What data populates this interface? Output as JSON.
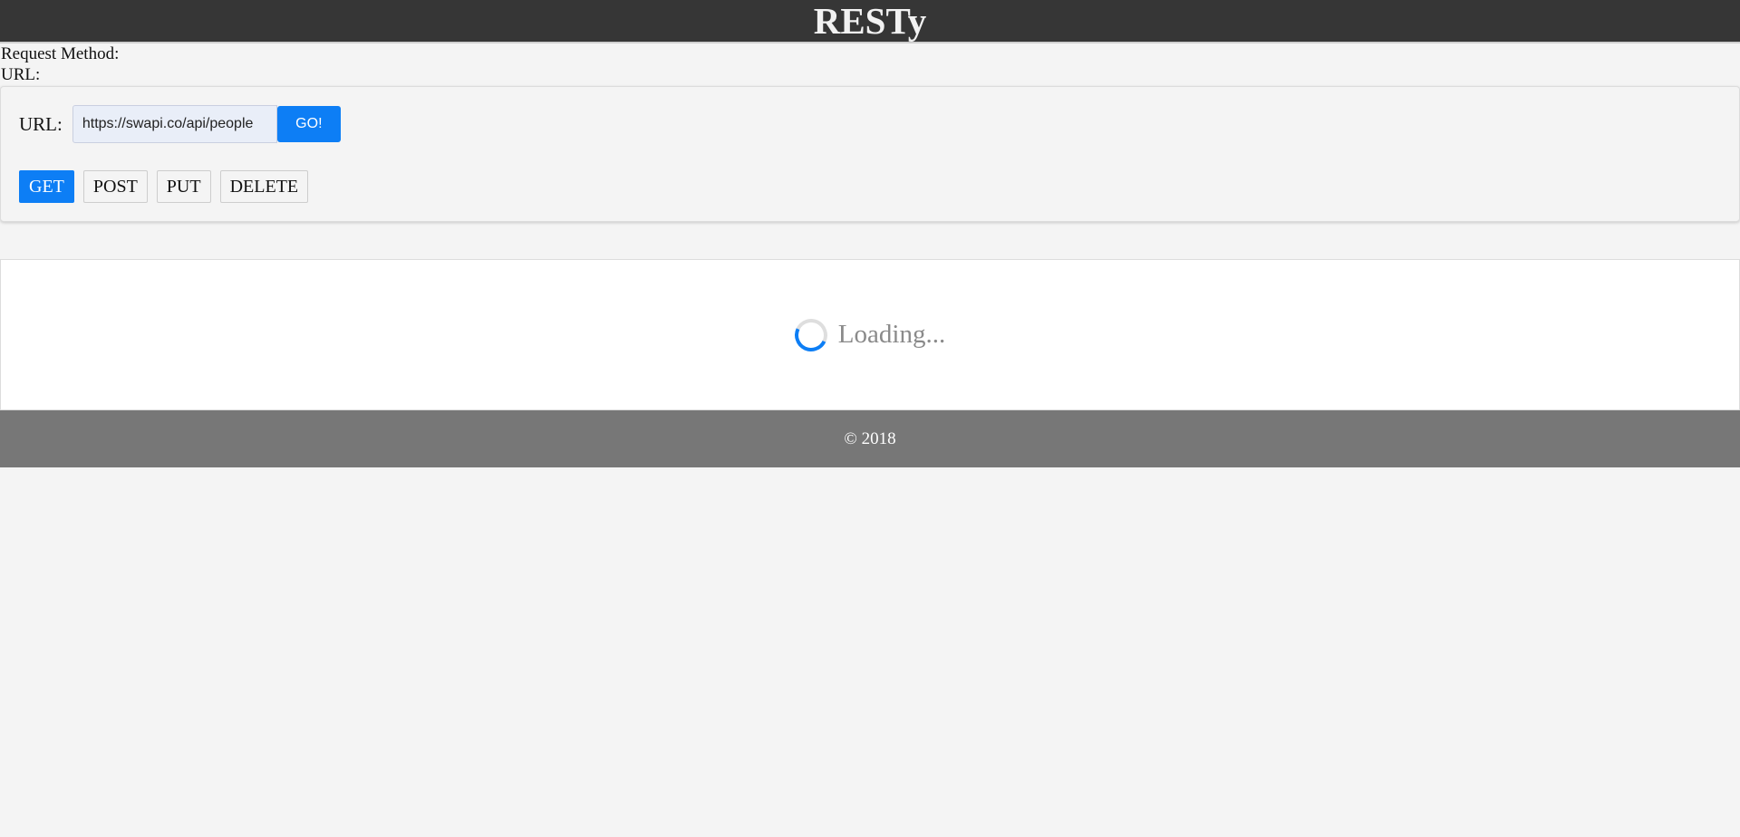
{
  "header": {
    "title": "RESTy"
  },
  "status": {
    "method_label": "Request Method:",
    "url_label": "URL:"
  },
  "form": {
    "url_label": "URL:",
    "url_value": "https://swapi.co/api/people",
    "go_label": "GO!",
    "methods": [
      {
        "label": "GET",
        "active": true
      },
      {
        "label": "POST",
        "active": false
      },
      {
        "label": "PUT",
        "active": false
      },
      {
        "label": "DELETE",
        "active": false
      }
    ]
  },
  "results": {
    "loading_text": "Loading...",
    "spinner_icon": "spinner-icon"
  },
  "footer": {
    "text": "© 2018"
  },
  "colors": {
    "header_bg": "#363636",
    "accent": "#0d7ef5",
    "footer_bg": "#777777",
    "page_bg": "#f4f4f4"
  }
}
